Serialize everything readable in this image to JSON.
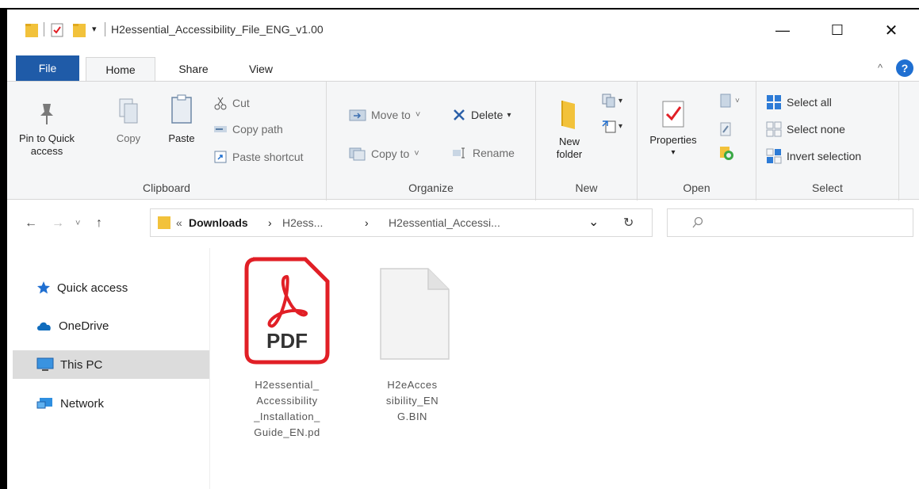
{
  "window": {
    "title": "H2essential_Accessibility_File_ENG_v1.00",
    "controls": {
      "minimize": "—",
      "maximize": "☐",
      "close": "✕"
    }
  },
  "tabs": [
    {
      "label": "File"
    },
    {
      "label": "Home"
    },
    {
      "label": "Share"
    },
    {
      "label": "View"
    }
  ],
  "ribbon": {
    "clipboard": {
      "label": "Clipboard",
      "pin": "Pin to Quick access",
      "pin_line1": "Pin to Quick",
      "pin_line2": "access",
      "copy": "Copy",
      "paste": "Paste",
      "cut": "Cut",
      "copy_path": "Copy path",
      "paste_shortcut": "Paste shortcut"
    },
    "organize": {
      "label": "Organize",
      "move_to": "Move to",
      "copy_to": "Copy to",
      "delete": "Delete",
      "rename": "Rename"
    },
    "new": {
      "label": "New",
      "new_folder_line1": "New",
      "new_folder_line2": "folder"
    },
    "open": {
      "label": "Open",
      "properties": "Properties"
    },
    "select": {
      "label": "Select",
      "select_all": "Select all",
      "select_none": "Select none",
      "invert_selection": "Invert selection"
    }
  },
  "address": {
    "prefix": "«",
    "crumbs": [
      "Downloads",
      "H2ess...",
      "H2essential_Accessi..."
    ],
    "separator": "›",
    "dropdown": "⌄",
    "refresh": "↻",
    "search_placeholder": ""
  },
  "navpane": {
    "items": [
      {
        "label": "Quick access",
        "icon": "star-icon"
      },
      {
        "label": "OneDrive",
        "icon": "cloud-icon"
      },
      {
        "label": "This PC",
        "icon": "monitor-icon",
        "selected": true
      },
      {
        "label": "Network",
        "icon": "network-icon"
      }
    ]
  },
  "files": [
    {
      "name": "H2essential_Accessibility_Installation_Guide_EN.pd",
      "lines": [
        "H2essential_",
        "Accessibility",
        "_Installation_",
        "Guide_EN.pd"
      ],
      "type": "pdf",
      "badge": "PDF"
    },
    {
      "name": "H2eAccessibility_ENG.BIN",
      "lines": [
        "H2eAcces",
        "sibility_EN",
        "G.BIN"
      ],
      "type": "bin"
    }
  ],
  "colors": {
    "accent": "#1f5ba8",
    "pdf_red": "#e11f26",
    "folder_yellow": "#f2c23b",
    "selection_bg": "#dcdcdc"
  }
}
